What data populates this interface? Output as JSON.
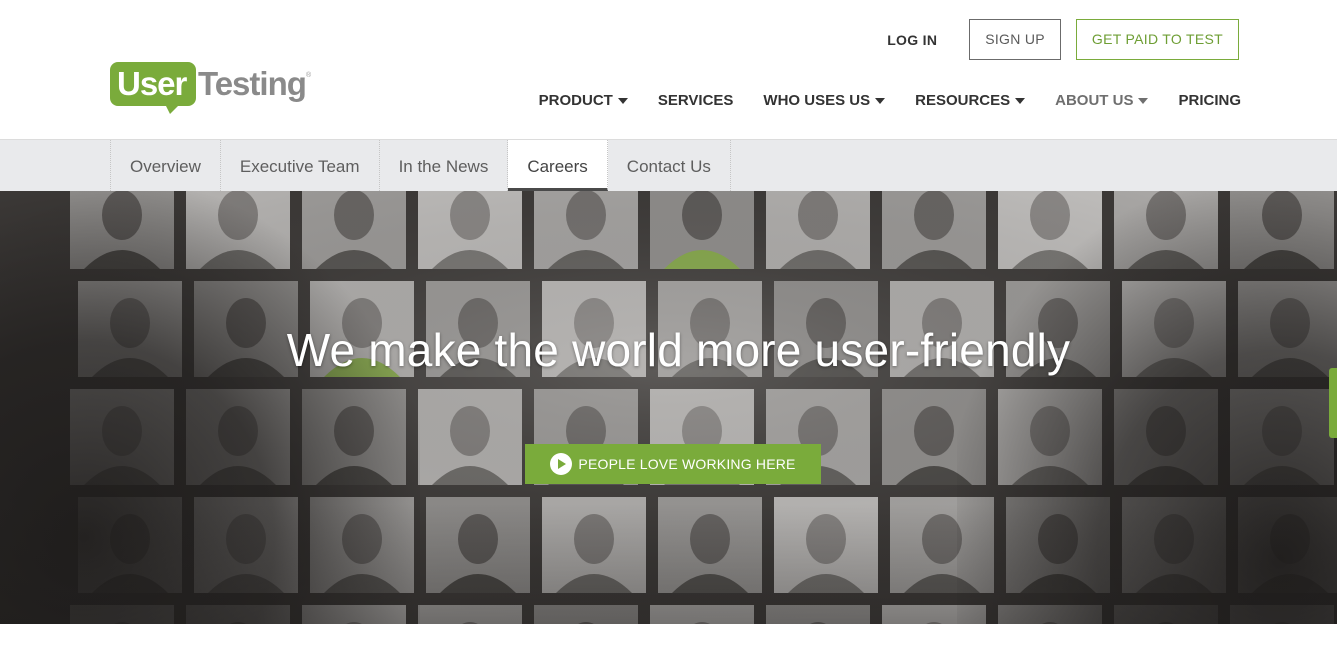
{
  "brand": {
    "logo_part1": "User",
    "logo_part2": "Testing",
    "logo_mark": "®",
    "accent_color": "#7aab3b"
  },
  "top_actions": {
    "login_label": "LOG IN",
    "signup_label": "SIGN UP",
    "get_paid_label": "GET PAID TO TEST"
  },
  "main_nav": {
    "items": [
      {
        "label": "PRODUCT",
        "has_dropdown": true
      },
      {
        "label": "SERVICES",
        "has_dropdown": false
      },
      {
        "label": "WHO USES US",
        "has_dropdown": true
      },
      {
        "label": "RESOURCES",
        "has_dropdown": true
      },
      {
        "label": "ABOUT US",
        "has_dropdown": true,
        "active": true
      },
      {
        "label": "PRICING",
        "has_dropdown": false
      }
    ]
  },
  "sub_nav": {
    "tabs": [
      {
        "label": "Overview"
      },
      {
        "label": "Executive Team"
      },
      {
        "label": "In the News"
      },
      {
        "label": "Careers",
        "active": true
      },
      {
        "label": "Contact Us"
      }
    ]
  },
  "hero": {
    "title": "We make the world more user-friendly",
    "cta_label": "PEOPLE LOVE WORKING HERE",
    "cta_icon": "play-circle-icon"
  }
}
